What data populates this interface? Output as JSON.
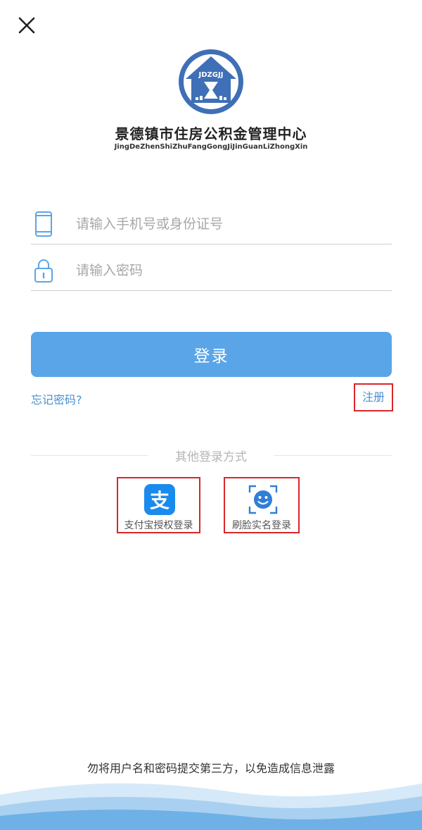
{
  "header": {
    "close_icon": "close-icon"
  },
  "branding": {
    "logo_text": "JDZGJJ",
    "org_name": "景德镇市住房公积金管理中心",
    "org_pinyin": "JingDeZhenShiZhuFangGongJiJinGuanLiZhongXin",
    "logo_color": "#3f6fb6"
  },
  "form": {
    "account_placeholder": "请输入手机号或身份证号",
    "account_value": "",
    "account_icon": "phone-icon",
    "password_placeholder": "请输入密码",
    "password_value": "",
    "password_icon": "lock-icon"
  },
  "actions": {
    "login_label": "登录",
    "forgot_label": "忘记密码?",
    "register_label": "注册",
    "primary_color": "#5aa5e8",
    "link_color": "#4a90d0"
  },
  "alt_login": {
    "divider_label": "其他登录方式",
    "methods": [
      {
        "label": "支付宝授权登录",
        "icon": "alipay-icon",
        "color": "#1a8bec"
      },
      {
        "label": "刷脸实名登录",
        "icon": "face-scan-icon",
        "color": "#2f7fd8"
      }
    ]
  },
  "footer": {
    "warning": "勿将用户名和密码提交第三方，以免造成信息泄露"
  }
}
